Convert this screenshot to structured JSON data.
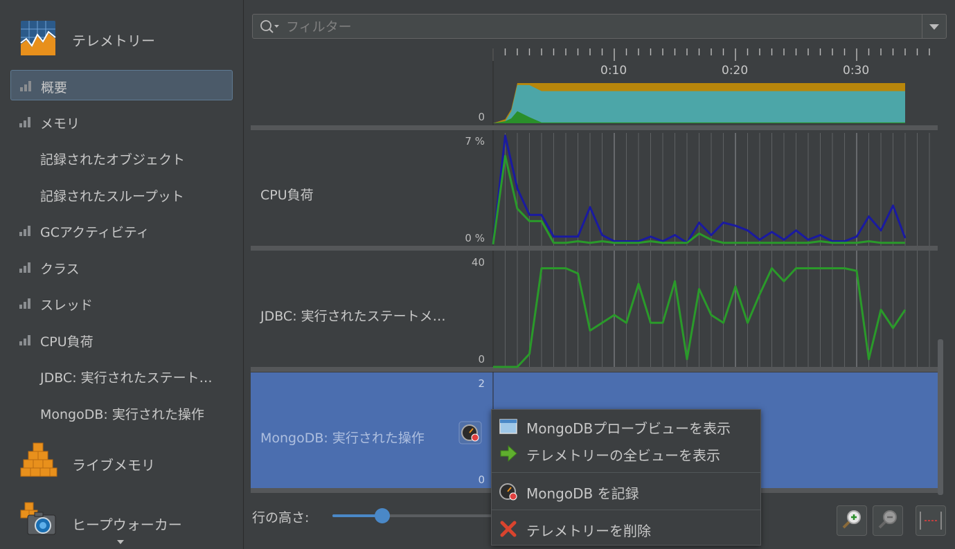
{
  "sidebar": {
    "telemetry_header": "テレメトリー",
    "items": [
      {
        "label": "概要",
        "has_icon": true,
        "selected": true
      },
      {
        "label": "メモリ",
        "has_icon": true
      },
      {
        "label": "記録されたオブジェクト",
        "has_icon": false
      },
      {
        "label": "記録されたスループット",
        "has_icon": false
      },
      {
        "label": "GCアクティビティ",
        "has_icon": true
      },
      {
        "label": "クラス",
        "has_icon": true
      },
      {
        "label": "スレッド",
        "has_icon": true
      },
      {
        "label": "CPU負荷",
        "has_icon": true
      },
      {
        "label": "JDBC: 実行されたステート…",
        "has_icon": false
      },
      {
        "label": "MongoDB: 実行された操作",
        "has_icon": false
      }
    ],
    "live_memory_header": "ライブメモリ",
    "heap_walker_header": "ヒープウォーカー"
  },
  "filter": {
    "placeholder": "フィルター"
  },
  "timeline": {
    "tick_labels": [
      "0:10",
      "0:20",
      "0:30"
    ]
  },
  "rows": {
    "memory": {
      "y_min": "0"
    },
    "cpu": {
      "label": "CPU負荷",
      "y_max": "7 %",
      "y_min": "0 %"
    },
    "jdbc": {
      "label": "JDBC: 実行されたステートメ…",
      "y_max": "40",
      "y_min": "0"
    },
    "mongodb": {
      "label": "MongoDB: 実行された操作",
      "y_max": "2",
      "y_min": "0"
    }
  },
  "chart_data": [
    {
      "type": "area",
      "title": "",
      "x_unit": "seconds",
      "x": [
        0,
        1,
        1.5,
        2,
        3,
        4,
        34
      ],
      "series": [
        {
          "values": [
            0,
            0.1,
            0.35,
            1.0,
            1.0,
            1.0,
            1.0
          ],
          "color": "#b8860b"
        },
        {
          "values": [
            0,
            0.05,
            0.3,
            0.95,
            0.95,
            0.8,
            0.8
          ],
          "color": "#4ca6a8"
        },
        {
          "values": [
            0,
            0.05,
            0.12,
            0.3,
            0.15,
            0.02,
            0.02
          ],
          "color": "#2a8f2a"
        }
      ]
    },
    {
      "type": "line",
      "title": "CPU負荷",
      "ylim": [
        0,
        7
      ],
      "x": [
        0,
        1,
        2,
        3,
        4,
        5,
        6,
        7,
        8,
        9,
        10,
        11,
        12,
        13,
        14,
        15,
        16,
        17,
        18,
        19,
        20,
        21,
        22,
        23,
        24,
        25,
        26,
        27,
        28,
        29,
        30,
        31,
        32,
        33,
        34
      ],
      "series": [
        {
          "color": "#1a1aa0",
          "values": [
            0,
            7.0,
            3.6,
            1.9,
            1.9,
            0.5,
            0.5,
            0.5,
            2.4,
            0.6,
            0.2,
            0.2,
            0.2,
            0.5,
            0.2,
            0.6,
            0.1,
            1.4,
            0.6,
            1.4,
            1.2,
            0.9,
            0.3,
            0.8,
            0.3,
            0.9,
            0.3,
            0.6,
            0.2,
            0.2,
            0.5,
            1.8,
            0.9,
            2.5,
            0.4
          ]
        },
        {
          "color": "#2a9a2a",
          "values": [
            0,
            5.7,
            2.3,
            1.5,
            1.5,
            0.1,
            0.1,
            0.2,
            0.1,
            0.2,
            0.1,
            0.1,
            0.1,
            0.2,
            0.1,
            0.1,
            0.1,
            0.7,
            0.3,
            0.1,
            0.1,
            0.1,
            0.1,
            0.1,
            0.1,
            0.1,
            0.1,
            0.2,
            0.1,
            0.1,
            0.1,
            0.2,
            0.1,
            0.1,
            0.1
          ]
        }
      ]
    },
    {
      "type": "line",
      "title": "JDBC: 実行されたステートメ…",
      "ylim": [
        0,
        40
      ],
      "x": [
        0,
        1,
        2,
        3,
        4,
        5,
        6,
        7,
        8,
        9,
        10,
        11,
        12,
        13,
        14,
        15,
        16,
        17,
        18,
        19,
        20,
        21,
        22,
        23,
        24,
        25,
        26,
        27,
        28,
        29,
        30,
        31,
        32,
        33,
        34
      ],
      "series": [
        {
          "color": "#2a9a2a",
          "values": [
            0,
            0,
            0,
            5,
            38,
            38,
            38,
            36,
            14,
            17,
            20,
            17,
            32,
            17,
            17,
            33,
            3,
            30,
            20,
            17,
            31,
            17,
            28,
            38,
            33,
            38,
            38,
            38,
            38,
            38,
            37,
            3,
            22,
            15,
            22
          ]
        }
      ]
    },
    {
      "type": "bar",
      "title": "MongoDB: 実行された操作",
      "ylim": [
        0,
        2
      ],
      "values": []
    }
  ],
  "row_height_label": "行の高さ:",
  "row_height_value": 0.3,
  "context_menu": {
    "items": [
      {
        "label": "MongoDBプローブビューを表示",
        "icon": "window-icon"
      },
      {
        "label": "テレメトリーの全ビューを表示",
        "icon": "green-arrow-icon"
      },
      {
        "label": "MongoDB を記録",
        "icon": "gauge-record-icon"
      },
      {
        "label": "テレメトリーを削除",
        "icon": "red-x-icon"
      }
    ]
  },
  "colors": {
    "background": "#3c3f41",
    "selected_row": "#4b6eaf",
    "accent": "#4a88c7"
  }
}
